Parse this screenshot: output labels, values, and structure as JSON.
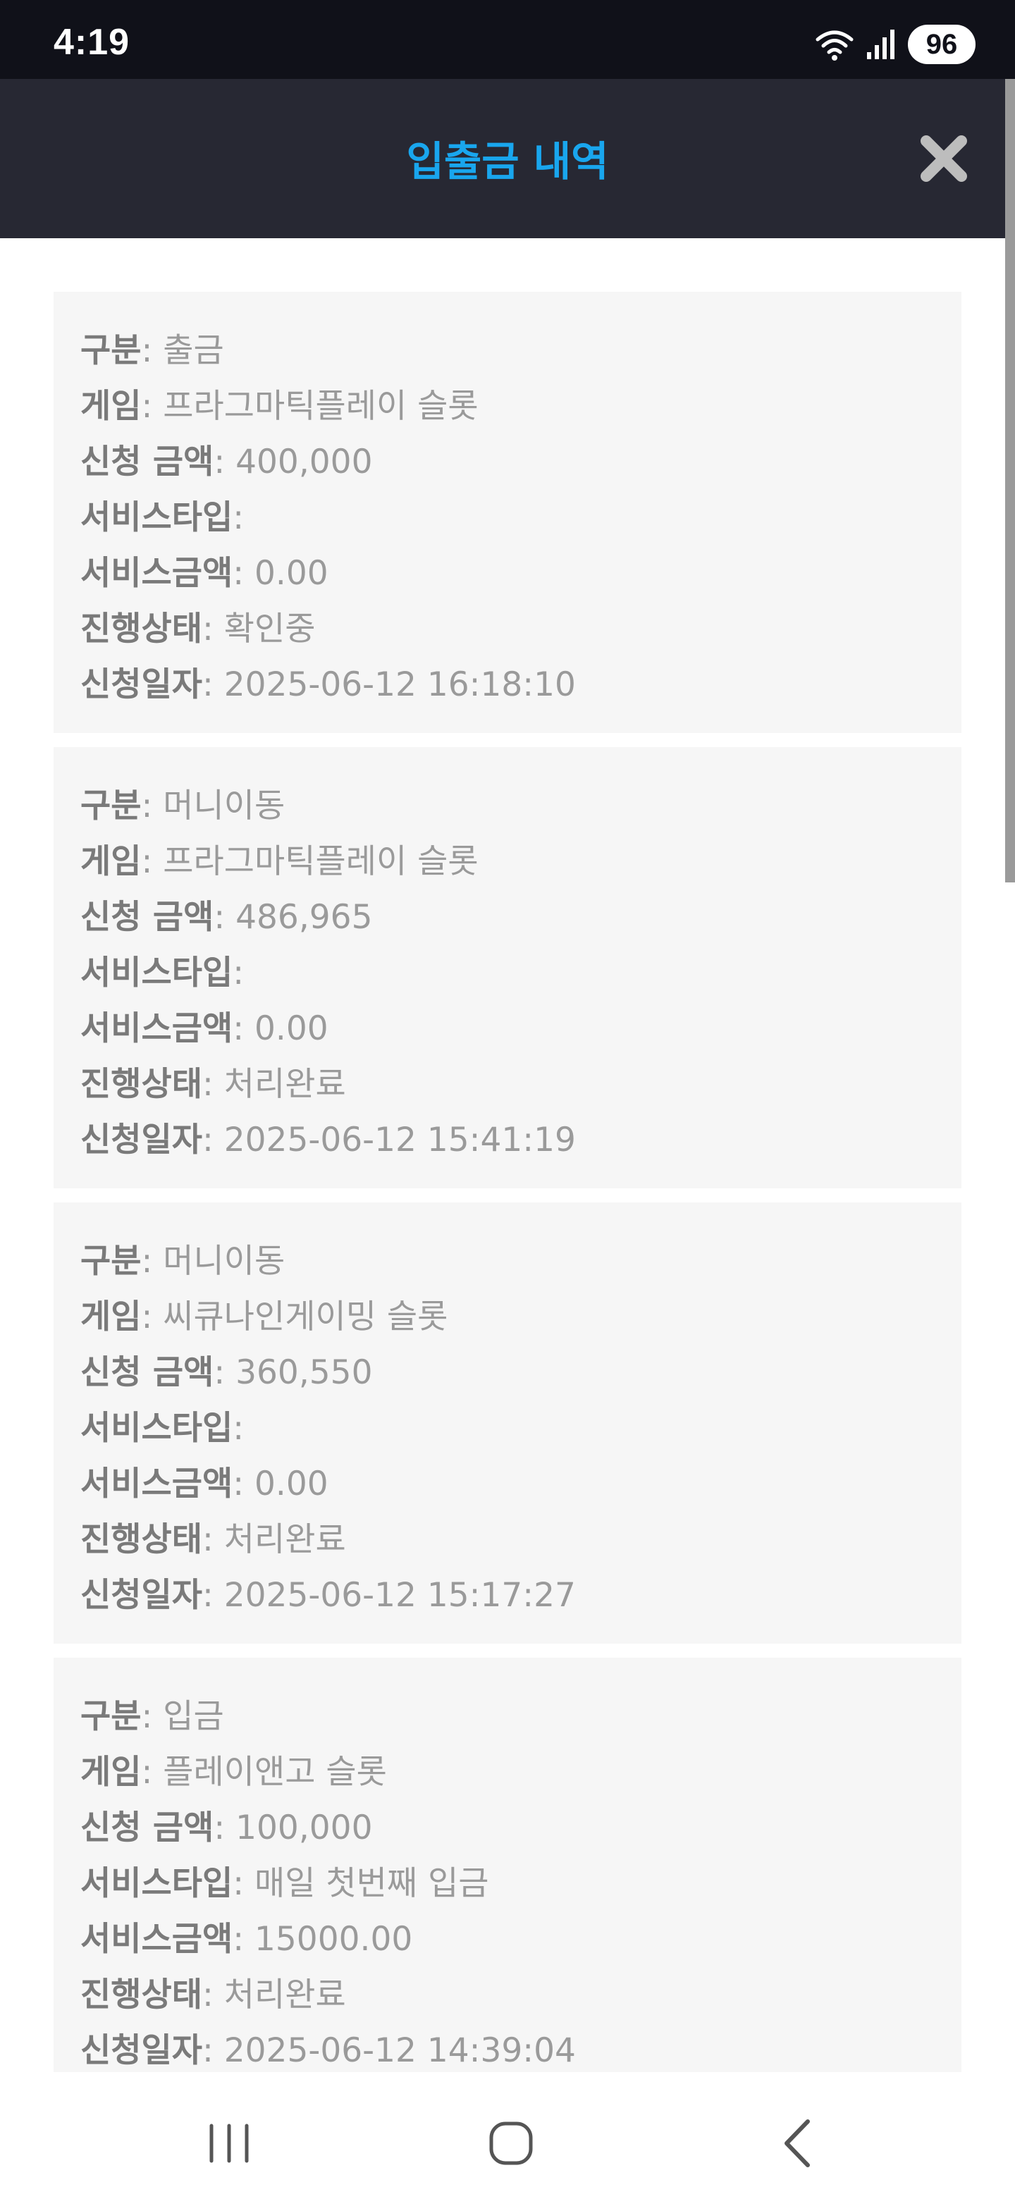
{
  "status": {
    "time": "4:19",
    "battery": "96",
    "icons": [
      "wifi-icon",
      "signal-icon",
      "battery-icon"
    ]
  },
  "header": {
    "title": "입출금 내역",
    "close_icon": "close-icon",
    "title_color": "#19a6ee",
    "bg_color": "#272833"
  },
  "labels": {
    "type": "구분",
    "game": "게임",
    "amount": "신청 금액",
    "service_type": "서비스타입",
    "service_amount": "서비스금액",
    "status": "진행상태",
    "date": "신청일자"
  },
  "records": [
    {
      "type": "출금",
      "game": "프라그마틱플레이 슬롯",
      "amount": "400,000",
      "service_type": "",
      "service_amount": "0.00",
      "status": "확인중",
      "date": "2025-06-12 16:18:10"
    },
    {
      "type": "머니이동",
      "game": "프라그마틱플레이 슬롯",
      "amount": "486,965",
      "service_type": "",
      "service_amount": "0.00",
      "status": "처리완료",
      "date": "2025-06-12 15:41:19"
    },
    {
      "type": "머니이동",
      "game": "씨큐나인게이밍 슬롯",
      "amount": "360,550",
      "service_type": "",
      "service_amount": "0.00",
      "status": "처리완료",
      "date": "2025-06-12 15:17:27"
    },
    {
      "type": "입금",
      "game": "플레이앤고 슬롯",
      "amount": "100,000",
      "service_type": "매일 첫번째 입금",
      "service_amount": "15000.00",
      "status": "처리완료",
      "date": "2025-06-12 14:39:04"
    }
  ],
  "navbar": {
    "icons": [
      "recent-apps-icon",
      "home-icon",
      "back-icon"
    ]
  }
}
